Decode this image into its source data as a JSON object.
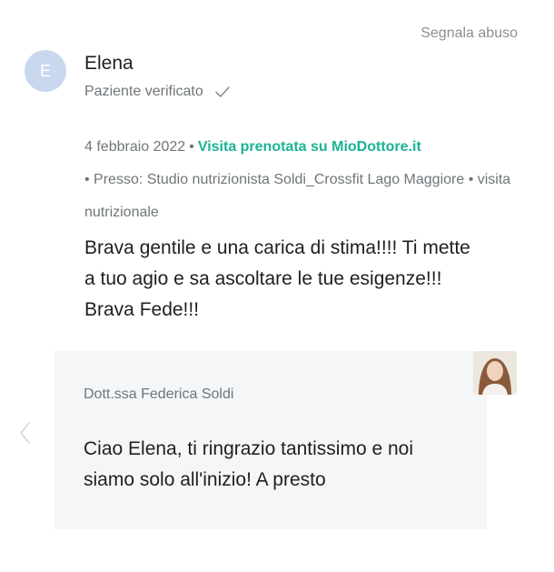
{
  "header": {
    "report_label": "Segnala abuso"
  },
  "review": {
    "avatar_initial": "E",
    "author": "Elena",
    "verified_label": "Paziente verificato",
    "date": "4 febbraio 2022",
    "separator": "•",
    "booking_label": "Visita prenotata su MioDottore.it",
    "location": "• Presso: Studio nutrizionista Soldi_Crossfit Lago Maggiore • visita nutrizionale",
    "text": "Brava gentile e una carica di stima!!!! Ti mette a tuo agio e sa ascoltare le tue esigenze!!! Brava Fede!!!"
  },
  "reply": {
    "doctor_name": "Dott.ssa Federica Soldi",
    "text": "Ciao Elena, ti ringrazio tantissimo e noi siamo solo all'inizio! A presto"
  },
  "icons": {
    "verified": "check-icon",
    "previous": "chevron-left-icon",
    "doctor_photo": "doctor-photo"
  },
  "colors": {
    "accent": "#19b394",
    "avatar": "#c9d8ef",
    "reply_background": "#f4f6f8",
    "muted_text": "#6f7579"
  }
}
